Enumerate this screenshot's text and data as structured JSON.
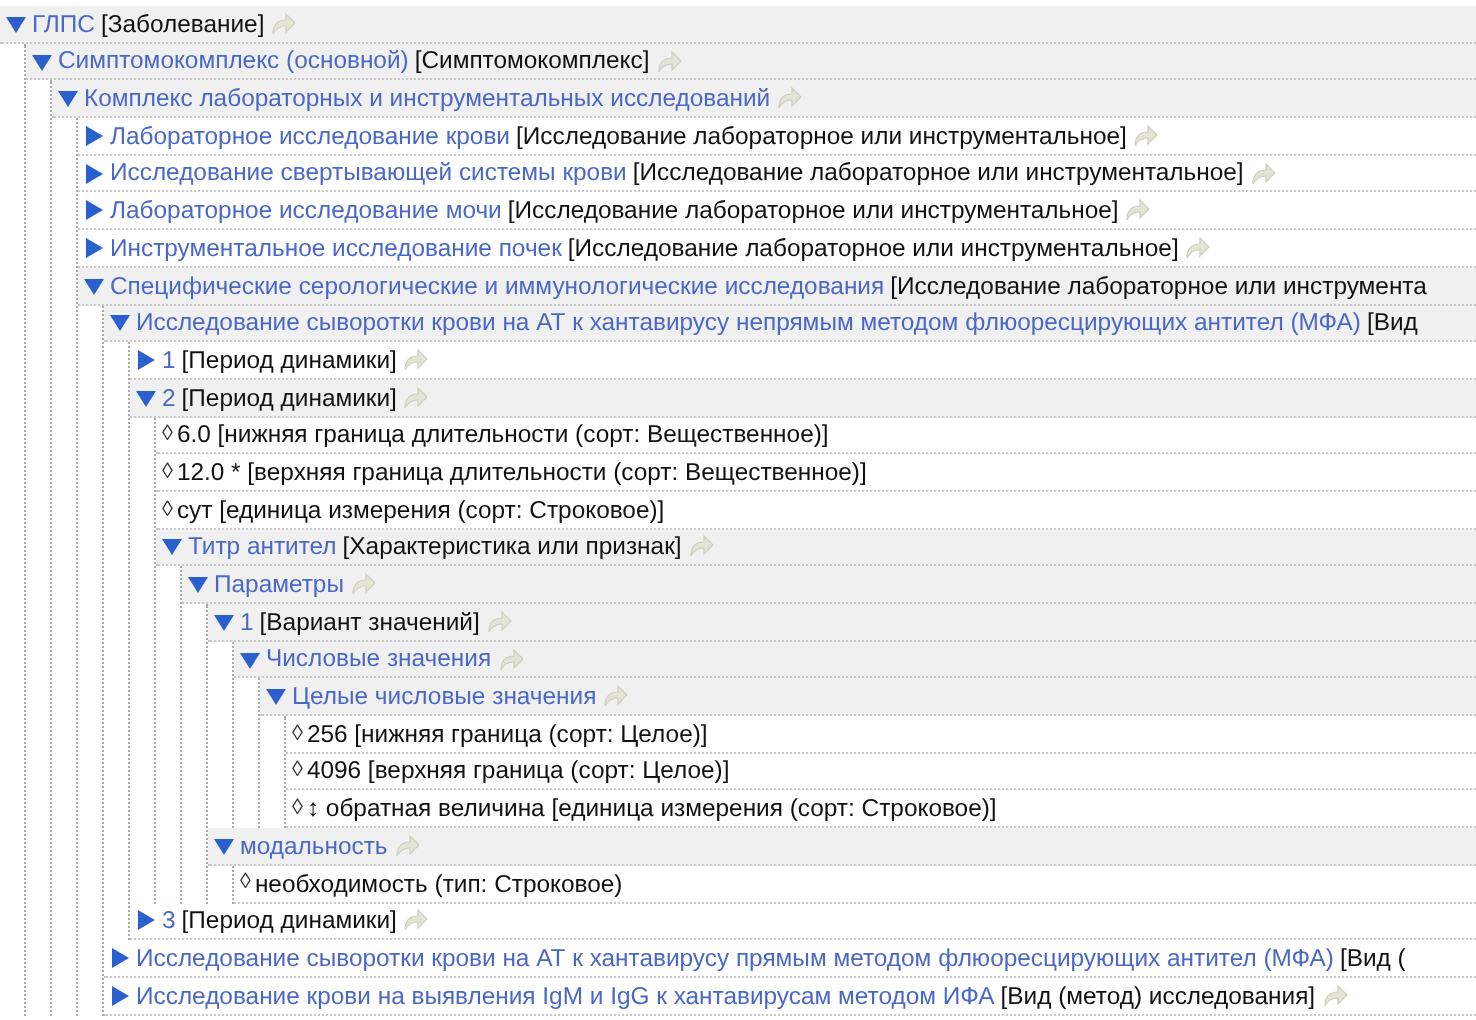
{
  "tree": [
    {
      "kind": "group",
      "name": "ГЛПС",
      "type": "[Заболевание]",
      "expanded": true,
      "link": true,
      "children": [
        {
          "kind": "group",
          "name": "Симптомокомплекс (основной)",
          "type": "[Симптомокомплекс]",
          "expanded": true,
          "link": true,
          "children": [
            {
              "kind": "group",
              "name": "Комплекс лабораторных и инструментальных исследований",
              "expanded": true,
              "link": true,
              "children": [
                {
                  "kind": "group",
                  "name": "Лабораторное исследование крови",
                  "type": "[Исследование лабораторное или инструментальное]",
                  "expanded": false,
                  "link": true
                },
                {
                  "kind": "group",
                  "name": "Исследование свертывающей системы крови",
                  "type": "[Исследование лабораторное или инструментальное]",
                  "expanded": false,
                  "link": true
                },
                {
                  "kind": "group",
                  "name": "Лабораторное исследование мочи",
                  "type": "[Исследование лабораторное или инструментальное]",
                  "expanded": false,
                  "link": true
                },
                {
                  "kind": "group",
                  "name": "Инструментальное исследование почек",
                  "type": "[Исследование лабораторное или инструментальное]",
                  "expanded": false,
                  "link": true
                },
                {
                  "kind": "group",
                  "name": "Специфические серологические и иммунологические исследования",
                  "type": "[Исследование лабораторное или инструмента",
                  "expanded": true,
                  "children": [
                    {
                      "kind": "group",
                      "name": "Исследование сыворотки крови на АТ к хантавирусу непрямым методом флюоресцирующих антител (МФА)",
                      "type": "[Вид",
                      "expanded": true,
                      "children": [
                        {
                          "kind": "group",
                          "name": "1",
                          "type": "[Период динамики]",
                          "expanded": false,
                          "link": true
                        },
                        {
                          "kind": "group",
                          "name": "2",
                          "type": "[Период динамики]",
                          "expanded": true,
                          "link": true,
                          "children": [
                            {
                              "kind": "value",
                              "marker": "◊",
                              "text": "6.0 [нижняя граница длительности (сорт: Вещественное)]"
                            },
                            {
                              "kind": "value",
                              "marker": "◊",
                              "text": "12.0 * [верхняя граница длительности (сорт: Вещественное)]"
                            },
                            {
                              "kind": "value",
                              "marker": "◊",
                              "text": "сут [единица измерения (сорт: Строковое)]"
                            },
                            {
                              "kind": "group",
                              "name": "Титр антител",
                              "type": "[Характеристика или признак]",
                              "expanded": true,
                              "link": true,
                              "children": [
                                {
                                  "kind": "group",
                                  "name": "Параметры",
                                  "expanded": true,
                                  "link": true,
                                  "children": [
                                    {
                                      "kind": "group",
                                      "name": "1",
                                      "type": "[Вариант значений]",
                                      "expanded": true,
                                      "link": true,
                                      "children": [
                                        {
                                          "kind": "group",
                                          "name": "Числовые значения",
                                          "expanded": true,
                                          "link": true,
                                          "children": [
                                            {
                                              "kind": "group",
                                              "name": "Целые числовые значения",
                                              "expanded": true,
                                              "link": true,
                                              "children": [
                                                {
                                                  "kind": "value",
                                                  "marker": "◊",
                                                  "text": "256 [нижняя граница (сорт: Целое)]"
                                                },
                                                {
                                                  "kind": "value",
                                                  "marker": "◊",
                                                  "text": "4096 [верхняя граница (сорт: Целое)]"
                                                },
                                                {
                                                  "kind": "value",
                                                  "marker": "◊",
                                                  "text": "↕ обратная величина [единица измерения (сорт: Строковое)]"
                                                }
                                              ]
                                            }
                                          ]
                                        }
                                      ]
                                    },
                                    {
                                      "kind": "group",
                                      "name": "модальность",
                                      "expanded": true,
                                      "link": true,
                                      "children": [
                                        {
                                          "kind": "value",
                                          "marker": "◊",
                                          "text": "необходимость (тип: Строковое)"
                                        }
                                      ]
                                    }
                                  ]
                                }
                              ]
                            }
                          ]
                        },
                        {
                          "kind": "group",
                          "name": "3",
                          "type": "[Период динамики]",
                          "expanded": false,
                          "link": true
                        }
                      ]
                    },
                    {
                      "kind": "group",
                      "name": "Исследование сыворотки крови на АТ к хантавирусу прямым методом флюоресцирующих антител (МФА)",
                      "type": "[Вид (",
                      "expanded": false
                    },
                    {
                      "kind": "group",
                      "name": "Исследование крови на выявления IgM и IgG к хантавирусам  методом ИФА",
                      "type": "[Вид (метод) исследования]",
                      "expanded": false,
                      "link": true
                    }
                  ]
                }
              ]
            }
          ]
        }
      ]
    }
  ]
}
